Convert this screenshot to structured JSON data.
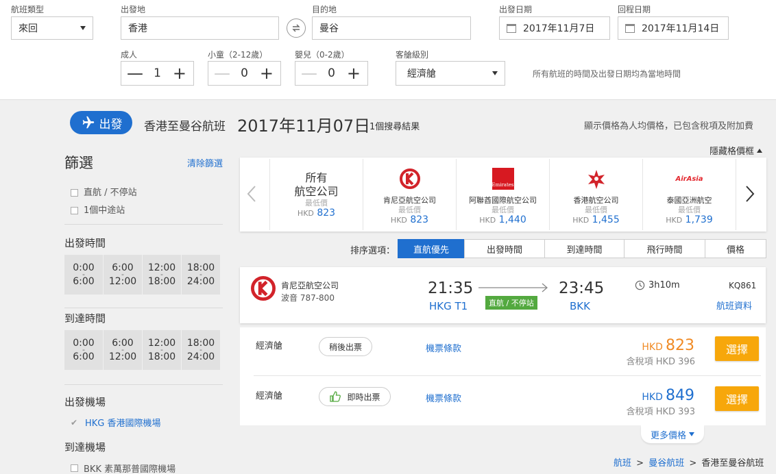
{
  "search": {
    "trip_type_label": "航班類型",
    "trip_type_value": "來回",
    "origin_label": "出發地",
    "origin_value": "香港",
    "destination_label": "目的地",
    "destination_value": "曼谷",
    "depart_date_label": "出發日期",
    "depart_date_value": "2017年11月7日",
    "return_date_label": "回程日期",
    "return_date_value": "2017年11月14日",
    "adults_label": "成人",
    "adults_value": "1",
    "children_label": "小童（2-12歲）",
    "children_value": "0",
    "infants_label": "嬰兒（0-2歲）",
    "infants_value": "0",
    "cabin_label": "客艙級別",
    "cabin_value": "經濟艙",
    "local_time_note": "所有航班的時間及出發日期均為當地時間",
    "minus_symbol": "—",
    "plus_symbol": "+"
  },
  "header": {
    "depart_pill": "出發",
    "route_title": "香港至曼谷航班",
    "date_title": "2017年11月07日",
    "result_count": "1個搜尋結果",
    "price_note": "顯示價格為人均價格，已包含稅項及附加費",
    "hide_price_grid": "隱藏格價框"
  },
  "filters": {
    "title": "篩選",
    "clear": "清除篩選",
    "stops": [
      "直航 / 不停站",
      "1個中途站"
    ],
    "depart_time_title": "出發時間",
    "arrive_time_title": "到達時間",
    "time_slots": [
      {
        "from": "0:00",
        "to": "6:00"
      },
      {
        "from": "6:00",
        "to": "12:00"
      },
      {
        "from": "12:00",
        "to": "18:00"
      },
      {
        "from": "18:00",
        "to": "24:00"
      }
    ],
    "dash": "-",
    "depart_airport_title": "出發機場",
    "depart_airport": "HKG 香港國際機場",
    "arrive_airport_title": "到達機場",
    "arrive_airport": "BKK 素萬那普國際機場"
  },
  "airlines_grid": {
    "min_label": "最低價",
    "currency": "HKD",
    "items": [
      {
        "name": "所有航空公司",
        "line1": "所有",
        "line2": "航空公司",
        "price": "823",
        "logo": "all"
      },
      {
        "name": "肯尼亞航空公司",
        "price": "823",
        "logo": "kenya-airways-logo"
      },
      {
        "name": "阿聯酋國際航空公司",
        "price": "1,440",
        "logo": "emirates-logo"
      },
      {
        "name": "香港航空公司",
        "price": "1,455",
        "logo": "hong-kong-airlines-logo"
      },
      {
        "name": "泰國亞洲航空",
        "price": "1,739",
        "logo": "airasia-logo"
      }
    ],
    "emirates_text": "Emirates",
    "airasia_text": "AirAsia"
  },
  "sort": {
    "label": "排序選項：",
    "options": [
      "直航優先",
      "出發時間",
      "到達時間",
      "飛行時間",
      "價格"
    ],
    "active_index": 0
  },
  "flight": {
    "airline": "肯尼亞航空公司",
    "aircraft": "波音 787-800",
    "depart_time": "21:35",
    "depart_airport": "HKG T1",
    "arrive_time": "23:45",
    "arrive_airport": "BKK",
    "stop_badge": "直航 / 不停站",
    "duration": "3h10m",
    "flight_no": "KQ861",
    "details_link": "航班資料"
  },
  "fares": [
    {
      "cabin": "經濟艙",
      "ticketing": "稍後出票",
      "terms": "機票條款",
      "currency": "HKD",
      "price": "823",
      "tax_label": "含稅項 HKD 396",
      "select": "選擇",
      "price_color": "#f08a24"
    },
    {
      "cabin": "經濟艙",
      "ticketing": "即時出票",
      "terms": "機票條款",
      "currency": "HKD",
      "price": "849",
      "tax_label": "含稅項 HKD 393",
      "select": "選擇",
      "price_color": "#1f6fcf"
    }
  ],
  "more_prices": "更多價格",
  "breadcrumb": [
    "航班",
    ">",
    "曼谷航班",
    ">",
    "香港至曼谷航班"
  ],
  "colors": {
    "brand_blue": "#1f6fcf",
    "accent_orange": "#f7a70b",
    "kenya_red": "#d2232a",
    "direct_green": "#53a93f"
  }
}
